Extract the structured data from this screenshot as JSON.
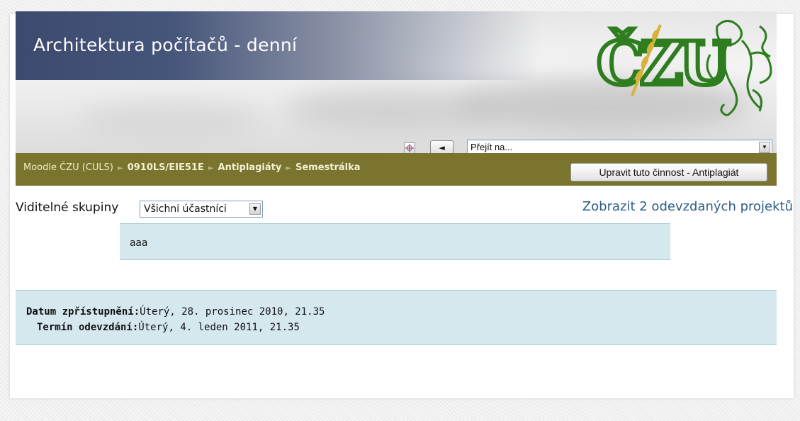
{
  "header": {
    "course_title": "Architektura počítačů - denní",
    "logo_text": "ČZU"
  },
  "jump": {
    "prev_label": "◄",
    "next_label": "►",
    "select_value": "Přejít na...",
    "arrow": "▼"
  },
  "breadcrumb": {
    "items": [
      "Moodle ČZU (CULS)",
      "0910LS/EIE51E",
      "Antiplagiáty",
      "Semestrálka"
    ],
    "separator": "►"
  },
  "edit_button_label": "Upravit tuto činnost - Antiplagiát",
  "groups": {
    "label": "Viditelné skupiny",
    "selected": "Všichni účastníci",
    "arrow": "▼"
  },
  "submitted_link": "Zobrazit 2 odevzdaných projektů",
  "intro_text": "aaa",
  "dates": {
    "available_label": "Datum zpřístupnění:",
    "available_value": "Úterý, 28. prosinec 2010, 21.35",
    "due_label": "Termín odevzdání:",
    "due_value": "Úterý, 4. leden 2011, 21.35"
  },
  "colors": {
    "title_band": "#3b4a6d",
    "navbar": "#7b742e",
    "info_box": "#d5e8ee",
    "link": "#2d5d86",
    "logo_green": "#2e7d1f",
    "logo_gold": "#d7b23a"
  }
}
